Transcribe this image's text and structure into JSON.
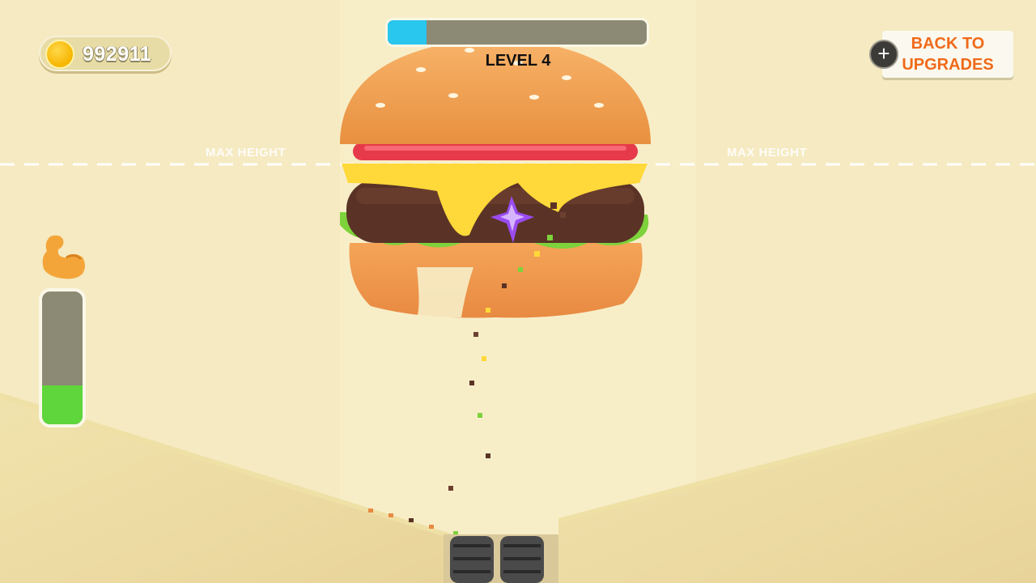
{
  "hud": {
    "coins": "992911",
    "level_label": "LEVEL 4",
    "level_progress": 0.15,
    "back_button": {
      "line1": "BACK TO",
      "line2": "UPGRADES"
    },
    "plus_symbol": "+",
    "power_level": 0.29
  },
  "scene": {
    "max_height_label": "MAX HEIGHT",
    "target_object": "burger",
    "colors": {
      "background": "#f6edc4",
      "bun": "#f2a55a",
      "patty": "#5a3326",
      "cheese": "#ffd83a",
      "lettuce": "#7ed23b",
      "tomato": "#e63a4a",
      "progress_fill": "#29c6ee",
      "power_fill": "#5fd63c",
      "button_text": "#f06a1a"
    }
  },
  "icons": [
    "coin-icon",
    "plus-icon",
    "muscle-icon",
    "crystal-spike-icon",
    "grinder-icon"
  ]
}
